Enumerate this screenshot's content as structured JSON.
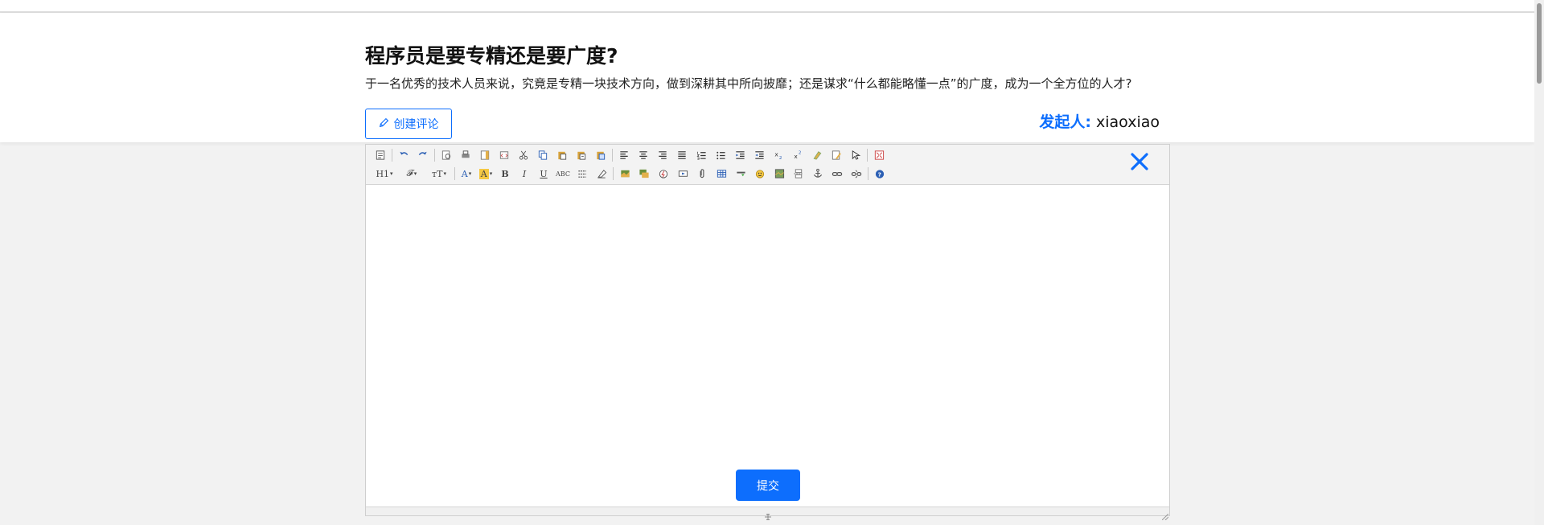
{
  "question": {
    "title": "程序员是要专精还是要广度?",
    "description": "于一名优秀的技术人员来说，究竟是专精一块技术方向，做到深耕其中所向披靡；还是谋求“什么都能略懂一点”的广度，成为一个全方位的人才?",
    "create_comment_label": "创建评论",
    "initiator_label": "发起人:",
    "initiator_name": "xiaoxiao"
  },
  "editor": {
    "submit_label": "提交",
    "toolbar": {
      "row1": [
        "source",
        "sep",
        "undo",
        "redo",
        "sep",
        "preview",
        "print",
        "template",
        "code",
        "cut",
        "copy",
        "paste",
        "paste-plain",
        "paste-word",
        "sep",
        "align-left",
        "align-center",
        "align-right",
        "align-justify",
        "ordered-list",
        "unordered-list",
        "indent",
        "outdent",
        "subscript",
        "superscript",
        "clear-format",
        "select-all",
        "selection",
        "sep",
        "fullscreen"
      ],
      "row2": [
        {
          "icon": "heading",
          "text": "H1"
        },
        {
          "icon": "font-family",
          "text": "𝓕"
        },
        {
          "icon": "font-size",
          "text": "тT"
        },
        {
          "icon": "sep",
          "text": ""
        },
        {
          "icon": "font-color",
          "text": "A"
        },
        {
          "icon": "highlight-color",
          "text": "A"
        },
        {
          "icon": "bold",
          "text": "B"
        },
        {
          "icon": "italic",
          "text": "I"
        },
        {
          "icon": "underline",
          "text": "U"
        },
        {
          "icon": "strikethrough",
          "text": "ABC"
        },
        {
          "icon": "line-height",
          "text": ""
        },
        {
          "icon": "remove-format",
          "text": ""
        },
        {
          "icon": "sep",
          "text": ""
        },
        {
          "icon": "image",
          "text": ""
        },
        {
          "icon": "multi-image",
          "text": ""
        },
        {
          "icon": "flash",
          "text": ""
        },
        {
          "icon": "media",
          "text": ""
        },
        {
          "icon": "attachment",
          "text": ""
        },
        {
          "icon": "table",
          "text": ""
        },
        {
          "icon": "horizontal-rule",
          "text": ""
        },
        {
          "icon": "emoticon",
          "text": ""
        },
        {
          "icon": "map",
          "text": ""
        },
        {
          "icon": "page-break",
          "text": ""
        },
        {
          "icon": "anchor",
          "text": ""
        },
        {
          "icon": "link",
          "text": ""
        },
        {
          "icon": "unlink",
          "text": ""
        },
        {
          "icon": "sep",
          "text": ""
        },
        {
          "icon": "help",
          "text": ""
        }
      ]
    }
  },
  "colors": {
    "accent": "#0d6efd",
    "background": "#f2f2f2"
  }
}
